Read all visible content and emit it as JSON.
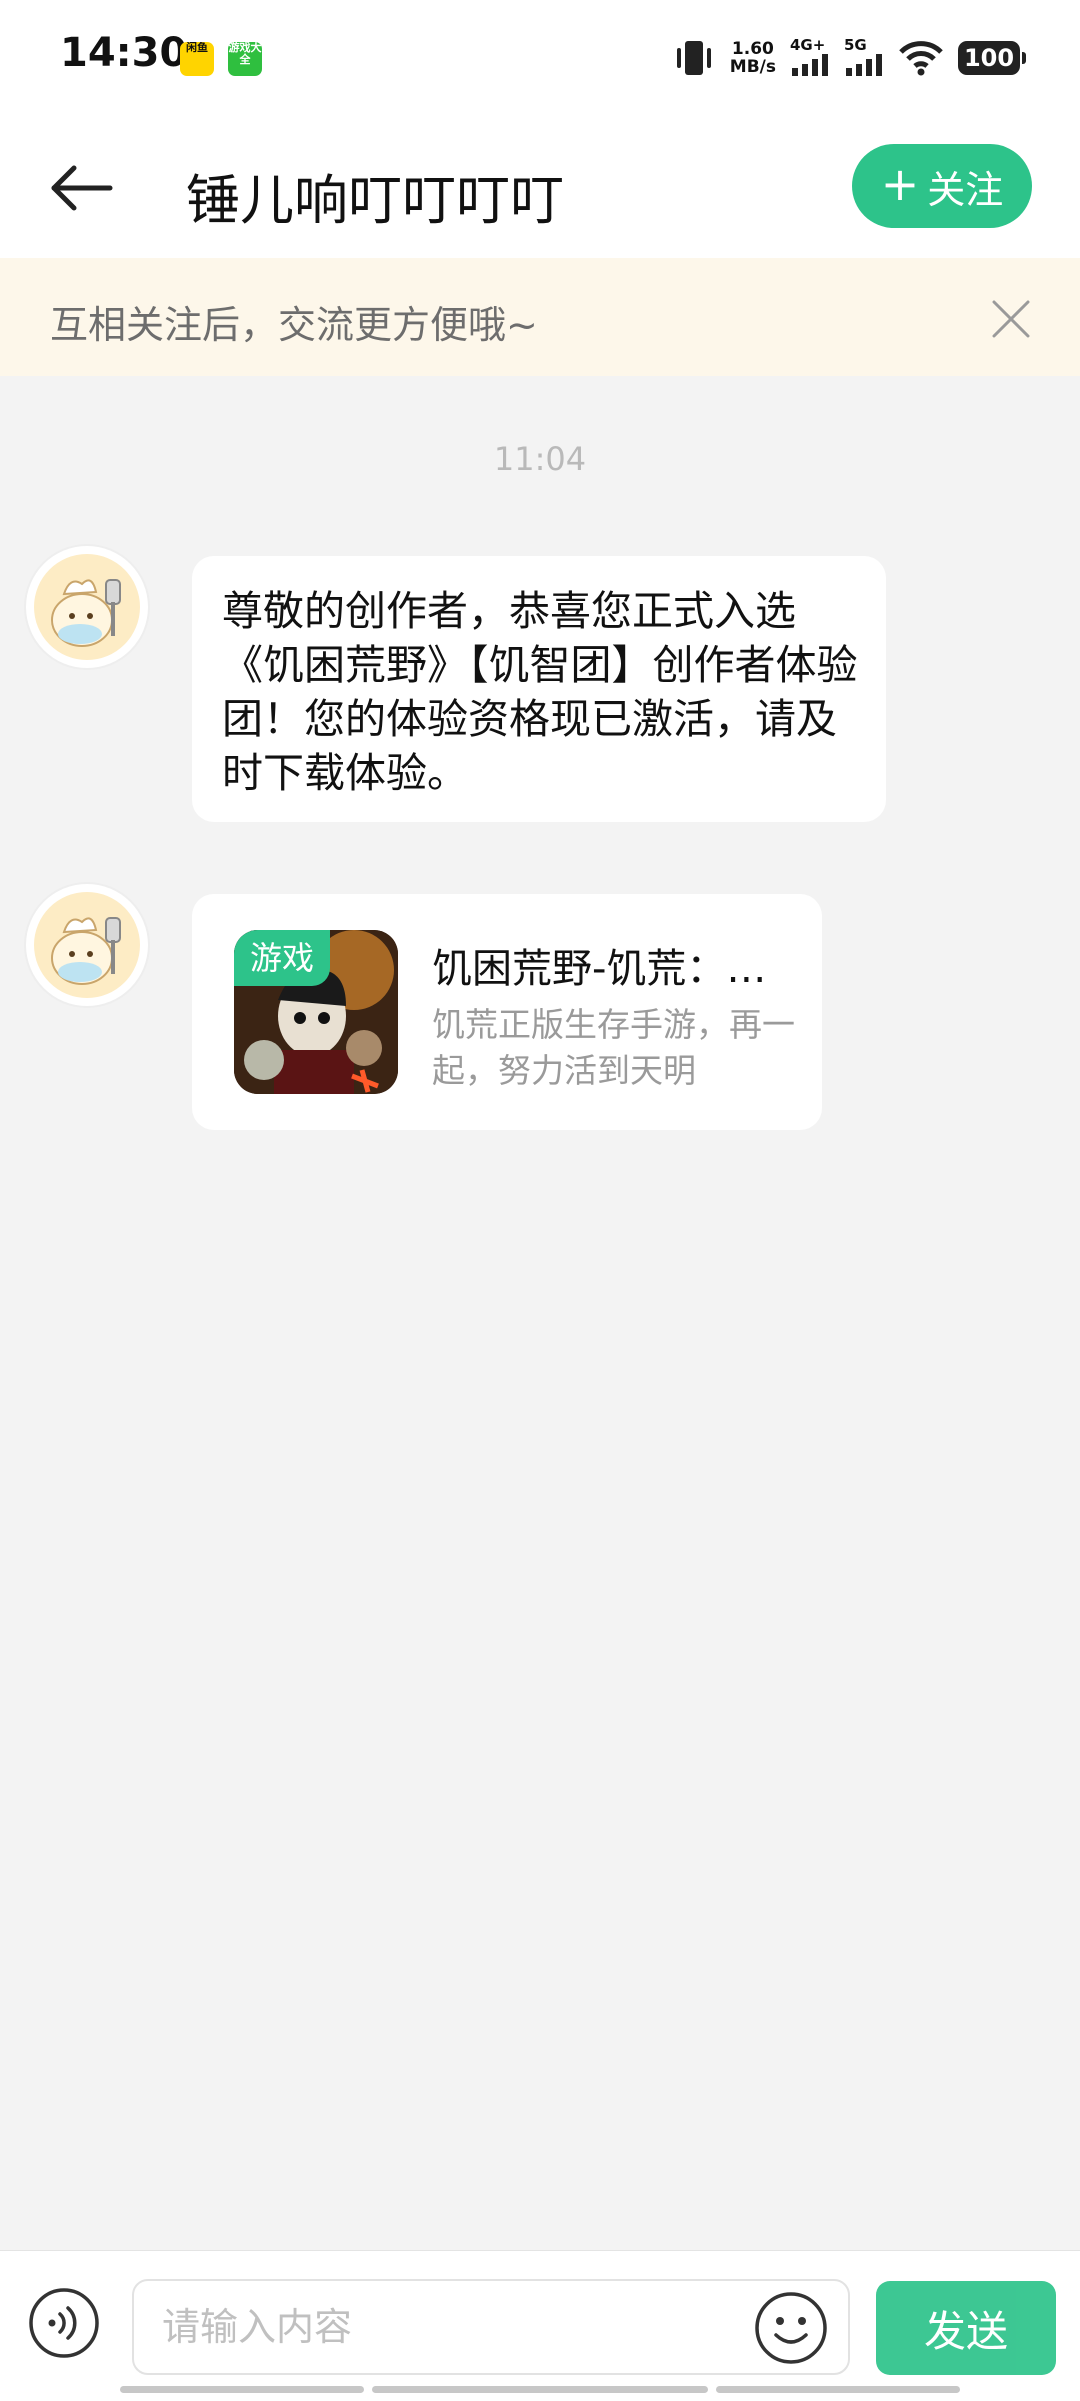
{
  "status_bar": {
    "time": "14:30",
    "app_icons": [
      "闲鱼",
      "游戏大全"
    ],
    "speed_value": "1.60",
    "speed_unit": "MB/s",
    "network1": "4G+",
    "network2": "5G",
    "battery": "100"
  },
  "header": {
    "title": "锤儿响叮叮叮叮",
    "follow_label": "关注"
  },
  "banner": {
    "text": "互相关注后，交流更方便哦~"
  },
  "chat": {
    "timestamp": "11:04",
    "messages": [
      {
        "text": "尊敬的创作者，恭喜您正式入选《饥困荒野》【饥智团】创作者体验团！您的体验资格现已激活，请及时下载体验。"
      },
      {
        "card": {
          "tag": "游戏",
          "title": "饥困荒野-饥荒：…",
          "desc": "饥荒正版生存手游，再一起，努力活到天明"
        }
      }
    ]
  },
  "input_bar": {
    "placeholder": "请输入内容",
    "send_label": "发送"
  },
  "colors": {
    "accent": "#2dc38a",
    "banner_bg": "#fdf7ea",
    "chat_bg": "#f3f3f3"
  },
  "icons": [
    "back-arrow-icon",
    "plus-icon",
    "close-icon",
    "voice-icon",
    "emoji-icon",
    "vibrate-icon",
    "signal-icon",
    "wifi-icon",
    "battery-icon"
  ]
}
